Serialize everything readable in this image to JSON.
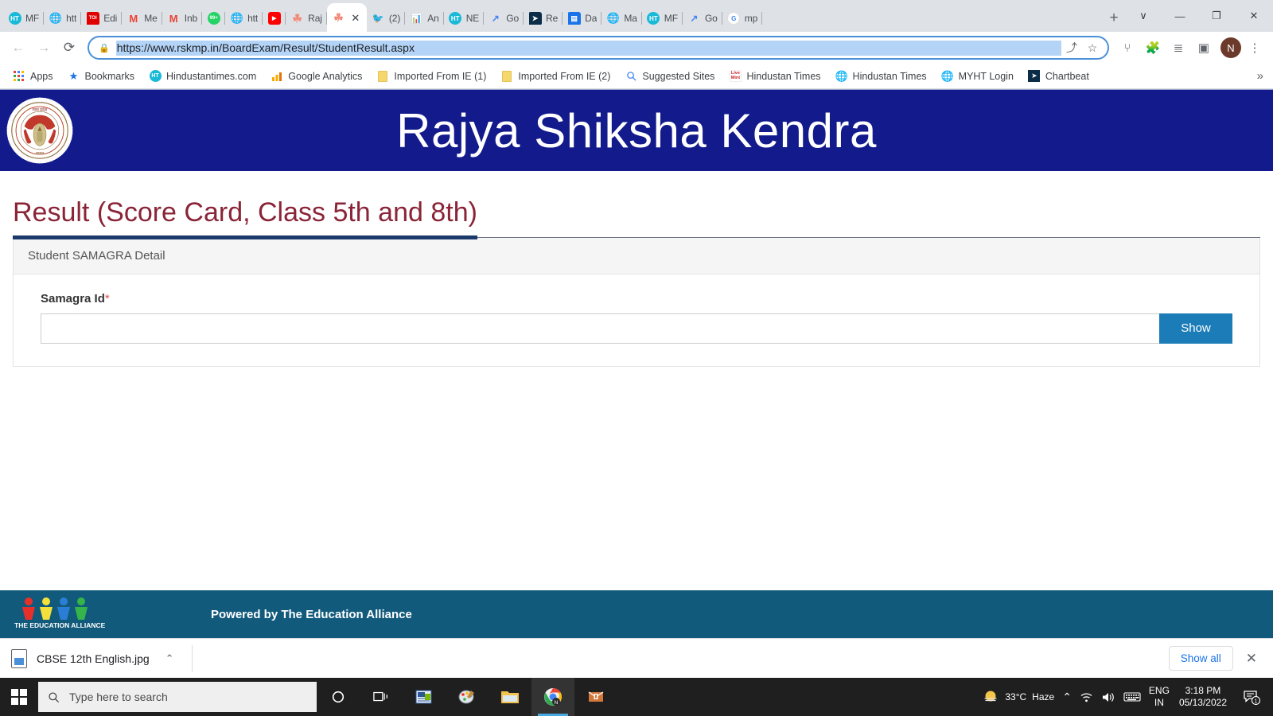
{
  "browser": {
    "tabs": [
      {
        "label": "MF",
        "icon": "ht-circle-icon",
        "color": "#19b9d8",
        "text": "HT",
        "active": false
      },
      {
        "label": "htt",
        "icon": "globe-icon",
        "color": "#6b7280",
        "text": "",
        "active": false
      },
      {
        "label": "Edi",
        "icon": "toi-icon",
        "color": "#e00000",
        "text": "TOI",
        "active": false
      },
      {
        "label": "Me",
        "icon": "gmail-icon",
        "color": "#ea4335",
        "text": "M",
        "active": false
      },
      {
        "label": "Inb",
        "icon": "gmail-icon",
        "color": "#ea4335",
        "text": "M",
        "active": false
      },
      {
        "label": "",
        "icon": "whatsapp-badge-icon",
        "color": "#25d366",
        "text": "99+",
        "active": false
      },
      {
        "label": "htt",
        "icon": "globe-icon",
        "color": "#6b7280",
        "text": "",
        "active": false
      },
      {
        "label": "",
        "icon": "youtube-icon",
        "color": "#ff0000",
        "text": "▶",
        "active": false
      },
      {
        "label": "Raj",
        "icon": "rskmp-emblem-icon",
        "color": "#f48a7a",
        "text": "",
        "active": false
      },
      {
        "label": "",
        "icon": "rskmp-emblem-icon",
        "color": "#f48a7a",
        "text": "",
        "active": true
      },
      {
        "label": "(2)",
        "icon": "twitter-icon",
        "color": "#1da1f2",
        "text": "🐦",
        "active": false
      },
      {
        "label": "An",
        "icon": "google-analytics-icon",
        "color": "#f9ab00",
        "text": "📊",
        "active": false
      },
      {
        "label": "NE",
        "icon": "ht-circle-icon",
        "color": "#19b9d8",
        "text": "HT",
        "active": false
      },
      {
        "label": "Go",
        "icon": "analytics-arrow-icon",
        "color": "#4285f4",
        "text": "↗",
        "active": false
      },
      {
        "label": "Re",
        "icon": "chartbeat-icon",
        "color": "#0c2d48",
        "text": "➤",
        "active": false
      },
      {
        "label": "Da",
        "icon": "docs-icon",
        "color": "#1a73e8",
        "text": "▤",
        "active": false
      },
      {
        "label": "Ma",
        "icon": "globe-icon",
        "color": "#6b7280",
        "text": "",
        "active": false
      },
      {
        "label": "MF",
        "icon": "ht-circle-icon",
        "color": "#19b9d8",
        "text": "HT",
        "active": false
      },
      {
        "label": "Go",
        "icon": "analytics-arrow-icon",
        "color": "#4285f4",
        "text": "↗",
        "active": false
      },
      {
        "label": "mp",
        "icon": "google-icon",
        "color": "#ffffff",
        "text": "G",
        "active": false
      }
    ],
    "new_tab_label": "+",
    "close_tab_label": "✕",
    "window_controls": {
      "tab_search": "∨",
      "minimize": "—",
      "maximize": "❐",
      "close": "✕"
    },
    "toolbar": {
      "back": "←",
      "forward": "→",
      "reload": "⟳",
      "lock_icon": "🔒",
      "url": "https://www.rskmp.in/BoardExam/Result/StudentResult.aspx",
      "share": "⤴",
      "bookmark_star": "☆",
      "extension_wave": "⑂",
      "extensions_puzzle": "🧩",
      "reading_list": "≣",
      "side_panel": "▣",
      "profile_initial": "N"
    },
    "bookmarks": [
      {
        "label": "Apps",
        "icon": "apps-grid-icon"
      },
      {
        "label": "Bookmarks",
        "icon": "star-icon"
      },
      {
        "label": "Hindustantimes.com",
        "icon": "ht-circle-icon"
      },
      {
        "label": "Google Analytics",
        "icon": "analytics-bars-icon"
      },
      {
        "label": "Imported From IE (1)",
        "icon": "folder-icon"
      },
      {
        "label": "Imported From IE (2)",
        "icon": "folder-icon"
      },
      {
        "label": "Suggested Sites",
        "icon": "search-icon"
      },
      {
        "label": "Hindustan Times",
        "icon": "livemint-icon"
      },
      {
        "label": "Hindustan Times",
        "icon": "globe-icon"
      },
      {
        "label": "MYHT Login",
        "icon": "globe-icon"
      },
      {
        "label": "Chartbeat",
        "icon": "chartbeat-icon"
      }
    ],
    "bookmarks_overflow": "»"
  },
  "site": {
    "header_title": "Rajya Shiksha Kendra",
    "emblem_name": "madhya-pradesh-government-emblem",
    "page_title": "Result (Score Card, Class 5th and 8th)",
    "card": {
      "heading": "Student SAMAGRA Detail",
      "field_label": "Samagra Id",
      "required_marker": "*",
      "input_value": "",
      "input_placeholder": "",
      "submit_label": "Show"
    },
    "footer": {
      "text": "Powered by The Education Alliance",
      "logo_caption": "THE EDUCATION ALLIANCE"
    }
  },
  "downloads": {
    "file_name": "CBSE 12th English.jpg",
    "chevron": "⌃",
    "show_all_label": "Show all",
    "close_label": "✕"
  },
  "taskbar": {
    "search_placeholder": "Type here to search",
    "items": [
      {
        "name": "cortana",
        "glyph": "◯"
      },
      {
        "name": "task-view",
        "glyph": "⧉"
      },
      {
        "name": "ms-office",
        "glyph": "📰"
      },
      {
        "name": "paint",
        "glyph": "🎨"
      },
      {
        "name": "file-explorer",
        "glyph": "📁"
      },
      {
        "name": "chrome",
        "glyph": "●"
      },
      {
        "name": "orange-app",
        "glyph": "■"
      }
    ],
    "tray": {
      "weather_temp": "33°C",
      "weather_desc": "Haze",
      "overflow": "⌃",
      "wifi": "◰",
      "volume": "🔊",
      "keyboard": "⌨",
      "lang_line1": "ENG",
      "lang_line2": "IN",
      "time": "3:18 PM",
      "date": "05/13/2022",
      "notification_count": "1"
    }
  }
}
